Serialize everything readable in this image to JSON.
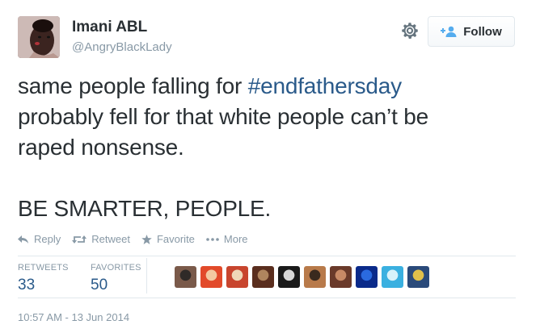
{
  "user": {
    "display_name": "Imani ABL",
    "handle": "@AngryBlackLady"
  },
  "follow_button": {
    "label": "Follow"
  },
  "tweet": {
    "line1_before": "same people falling for ",
    "hashtag": "#endfathersday",
    "line2": "probably fell for that white people can’t be",
    "line3": "raped nonsense.",
    "line4": "BE SMARTER, PEOPLE."
  },
  "actions": {
    "reply": "Reply",
    "retweet": "Retweet",
    "favorite": "Favorite",
    "more": "More"
  },
  "stats": {
    "retweets_label": "RETWEETS",
    "retweets_count": "33",
    "favorites_label": "FAVORITES",
    "favorites_count": "50"
  },
  "timestamp": "10:57 AM - 13 Jun 2014",
  "colors": {
    "link": "#2a5a8a",
    "muted": "#8899a6",
    "text": "#292f33",
    "border": "#e1e8ed",
    "follow_icon": "#55acee"
  },
  "icons": {
    "settings": "gear-icon",
    "follow": "add-user-icon",
    "reply": "reply-arrow-icon",
    "retweet": "retweet-icon",
    "favorite": "star-icon",
    "more": "ellipsis-icon"
  },
  "favoriter_avatars": [
    {
      "name": "favoriter-avatar-1",
      "c1": "#7a5a4a",
      "c2": "#2f2a28"
    },
    {
      "name": "favoriter-avatar-2",
      "c1": "#e24a2a",
      "c2": "#f3c9a0"
    },
    {
      "name": "favoriter-avatar-3",
      "c1": "#c8452e",
      "c2": "#f0d8b8"
    },
    {
      "name": "favoriter-avatar-4",
      "c1": "#5a2e1e",
      "c2": "#b0855e"
    },
    {
      "name": "favoriter-avatar-5",
      "c1": "#1a1a1a",
      "c2": "#d8d8d8"
    },
    {
      "name": "favoriter-avatar-6",
      "c1": "#b87a4a",
      "c2": "#3a2a1e"
    },
    {
      "name": "favoriter-avatar-7",
      "c1": "#6a3a2a",
      "c2": "#c88a66"
    },
    {
      "name": "favoriter-avatar-8",
      "c1": "#0a2a8a",
      "c2": "#2a6ae0"
    },
    {
      "name": "favoriter-avatar-9",
      "c1": "#3ab0e0",
      "c2": "#d8f2fa"
    },
    {
      "name": "favoriter-avatar-10",
      "c1": "#2a4a7a",
      "c2": "#e0c04a"
    }
  ]
}
